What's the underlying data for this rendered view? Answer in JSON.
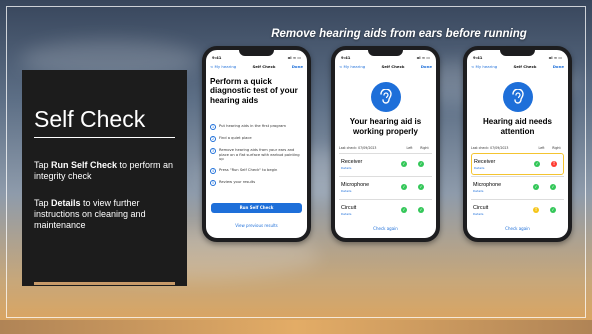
{
  "slide": {
    "headline": "Remove hearing aids from ears before running",
    "panel": {
      "title": "Self Check",
      "para1_bold": "Run Self Check",
      "para1_pre": "Tap ",
      "para1_post": " to perform an integrity check",
      "para2_pre": "Tap ",
      "para2_bold": "Details",
      "para2_post": " to view further instructions on cleaning and maintenance"
    }
  },
  "phones": {
    "status_time": "9:41",
    "status_signal": "ııl ≈ ▭",
    "nav_back": "< My hearing",
    "nav_title": "Self Check",
    "nav_done": "Done",
    "p1": {
      "title": "Perform a quick diagnostic test of your hearing aids",
      "steps": [
        {
          "n": "1",
          "text": "Put hearing aids in the first program"
        },
        {
          "n": "2",
          "text": "Find a quiet place"
        },
        {
          "n": "3",
          "text": "Remove hearing aids from your ears and place on a flat surface with earbud pointing up"
        },
        {
          "n": "4",
          "text": "Press \"Run Self Check\" to begin"
        },
        {
          "n": "5",
          "text": "Review your results"
        }
      ],
      "run_button": "Run Self Check",
      "previous_link": "View previous results"
    },
    "p2": {
      "title": "Your hearing aid is working properly",
      "last_check": "Last check: 07/09/2023",
      "col_left": "Left",
      "col_right": "Right",
      "rows": [
        {
          "name": "Receiver",
          "details": "Details"
        },
        {
          "name": "Microphone",
          "details": "Details"
        },
        {
          "name": "Circuit",
          "details": "Details"
        }
      ],
      "check_again": "Check again"
    },
    "p3": {
      "title": "Hearing aid needs attention",
      "last_check": "Last check: 07/09/2023",
      "col_left": "Left",
      "col_right": "Right",
      "rows": [
        {
          "name": "Receiver",
          "details": "Details"
        },
        {
          "name": "Microphone",
          "details": "Details"
        },
        {
          "name": "Circuit",
          "details": "Details"
        }
      ],
      "check_again": "Check again"
    }
  },
  "colors": {
    "accent": "#1e6fd9",
    "ok": "#34c759",
    "error": "#ff3b30",
    "warning": "#f5c518",
    "highlight": "#f4c430"
  }
}
